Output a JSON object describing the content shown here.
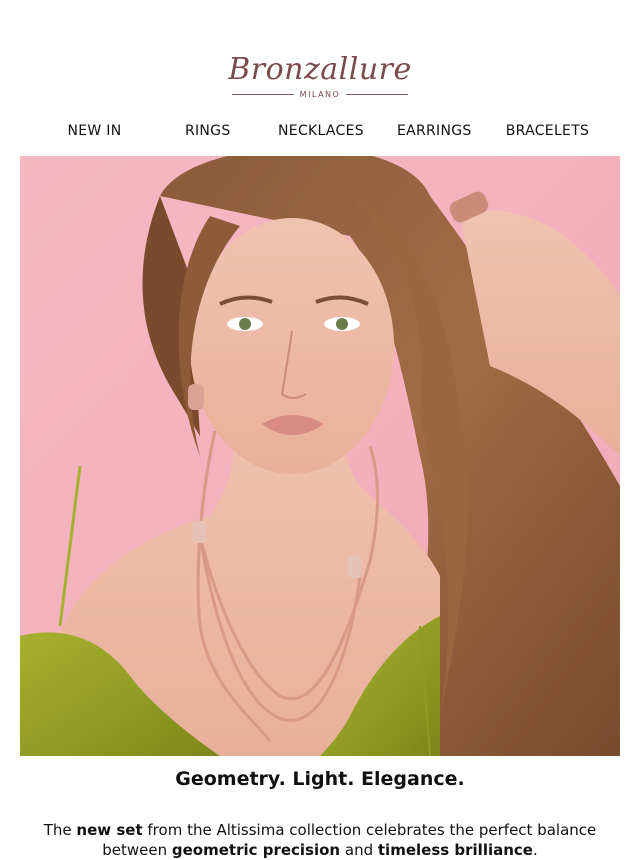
{
  "brand": {
    "name": "Bronzallure",
    "tagline": "MILANO"
  },
  "nav": [
    {
      "label": "NEW IN"
    },
    {
      "label": "RINGS"
    },
    {
      "label": "NECKLACES"
    },
    {
      "label": "EARRINGS"
    },
    {
      "label": "BRACELETS"
    }
  ],
  "hero": {
    "alt": "Model wearing rose gold multi-strand necklace, earrings and bracelet"
  },
  "headline": "Geometry. Light. Elegance.",
  "intro": {
    "p1": "The ",
    "b1": "new set",
    "p2": " from the Altissima collection celebrates the perfect balance between ",
    "b2": "geometric precision",
    "p3": " and ",
    "b3": "timeless brilliance",
    "p4": "."
  },
  "colors": {
    "background_pink": "#f3b3bf",
    "dress_green": "#9aa52a",
    "brand_brown": "#7a4a4c",
    "rose_gold": "#d79a86"
  }
}
